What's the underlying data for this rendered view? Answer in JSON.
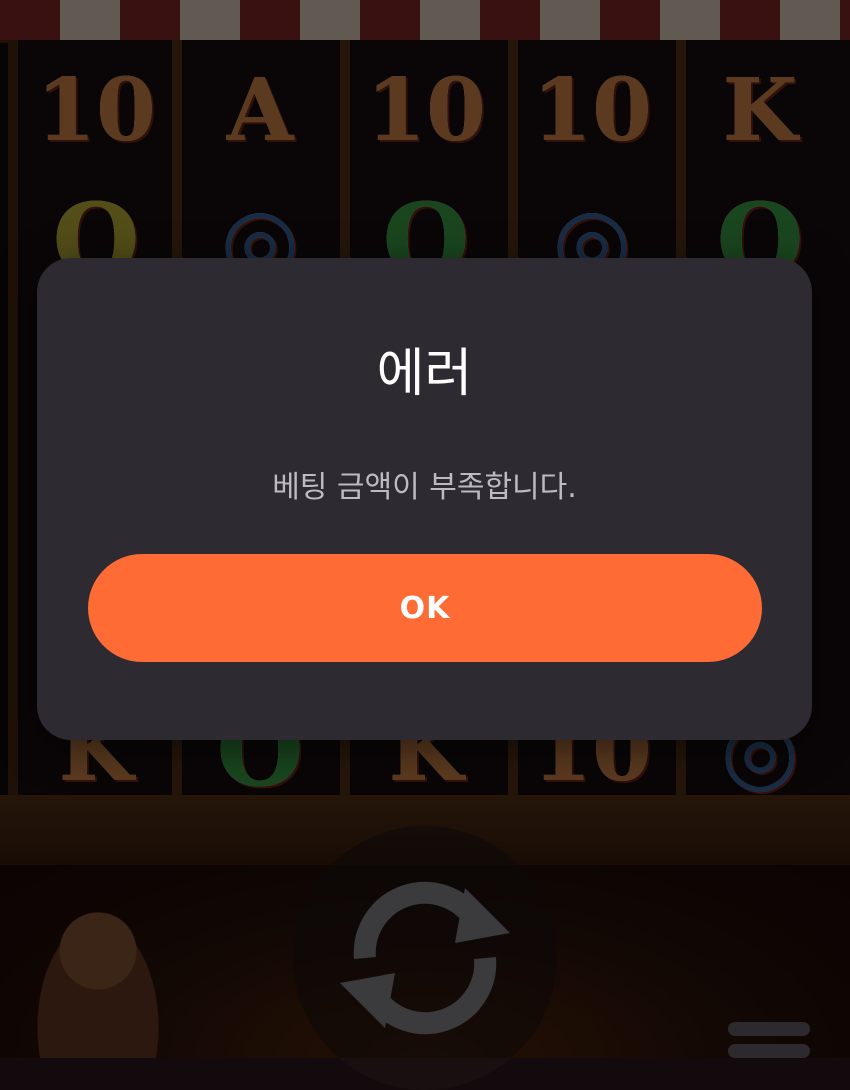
{
  "dialog": {
    "title": "에러",
    "message": "베팅 금액이 부족합니다.",
    "ok_label": "OK"
  },
  "reels": {
    "row1": [
      "10",
      "A",
      "10",
      "10",
      "K"
    ],
    "row2": [
      "O",
      "◎",
      "O",
      "◎",
      "O"
    ],
    "row_bottom": [
      "K",
      "O",
      "K",
      "10",
      "◎"
    ]
  },
  "colors": {
    "dialog_bg": "#2d2b31",
    "accent": "#ff6b35",
    "title_text": "#ffffff",
    "message_text": "#bdbac2"
  },
  "icons": {
    "spin": "refresh-arrows-icon",
    "menu": "hamburger-menu-icon"
  }
}
